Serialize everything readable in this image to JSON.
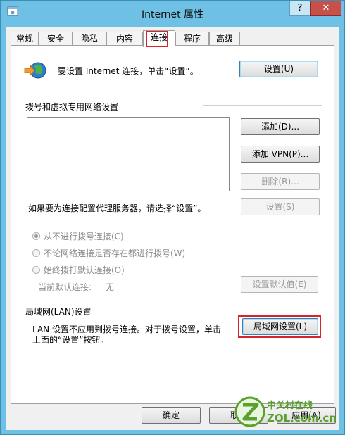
{
  "window": {
    "title": "Internet 属性",
    "help_glyph": "?",
    "close_glyph": "✕",
    "icon": "internet-options-icon"
  },
  "tabs": [
    {
      "label": "常规"
    },
    {
      "label": "安全"
    },
    {
      "label": "隐私"
    },
    {
      "label": "内容"
    },
    {
      "label": "连接",
      "active": true
    },
    {
      "label": "程序"
    },
    {
      "label": "高级"
    }
  ],
  "setup": {
    "icon": "globe-arrow-icon",
    "text": "要设置 Internet 连接，单击“设置”。",
    "button": "设置(U)"
  },
  "dialup": {
    "heading": "拨号和虚拟专用网络设置",
    "add_button": "添加(D)...",
    "add_vpn_button": "添加 VPN(P)...",
    "remove_button": "删除(R)...",
    "proxy_text": "如果要为连接配置代理服务器，请选择“设置”。",
    "settings_button": "设置(S)",
    "radio_never": "从不进行拨号连接(C)",
    "radio_no_network": "不论网络连接是否存在都进行拨号(W)",
    "radio_always": "始终拨打默认连接(O)",
    "current_default_label": "当前默认连接:",
    "current_default_value": "无",
    "set_default_button": "设置默认值(E)"
  },
  "lan": {
    "heading": "局域网(LAN)设置",
    "description_line1": "LAN 设置不应用到拨号连接。对于拨号设置，单击",
    "description_line2": "上面的“设置”按钮。",
    "button": "局域网设置(L)"
  },
  "footer": {
    "ok_button": "确定",
    "cancel_button": "取消",
    "apply_button": "应用(A)"
  },
  "watermark": {
    "cn": "中关村在线",
    "en": "ZOL.com.cn"
  },
  "colors": {
    "titlebar": "#6ec1e4",
    "close_button": "#c7514a",
    "highlight": "#d8232a",
    "watermark_green": "#5aa02c"
  }
}
